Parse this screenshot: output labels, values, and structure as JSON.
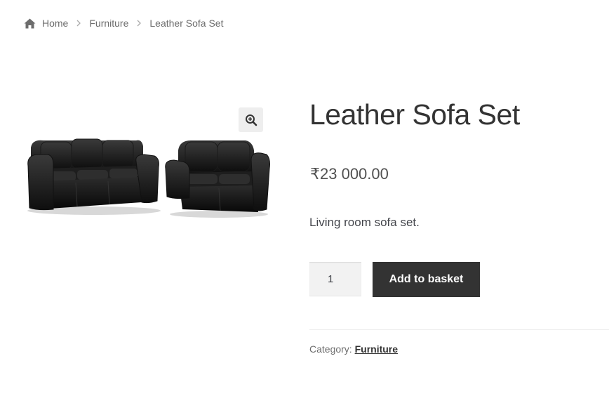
{
  "breadcrumb": {
    "home": "Home",
    "category": "Furniture",
    "current": "Leather Sofa Set"
  },
  "product": {
    "title": "Leather Sofa Set",
    "price": "₹23 000.00",
    "description": "Living room sofa set.",
    "quantity": "1",
    "add_to_basket": "Add to basket",
    "category_label": "Category:",
    "category_link": "Furniture"
  },
  "icons": {
    "home": "home-icon",
    "separator": "chevron-right-icon",
    "zoom": "zoom-in-icon"
  },
  "colors": {
    "button_bg": "#333333",
    "button_text": "#ffffff",
    "qty_bg": "#f2f2f2",
    "zoom_bg": "#eeeeee"
  }
}
